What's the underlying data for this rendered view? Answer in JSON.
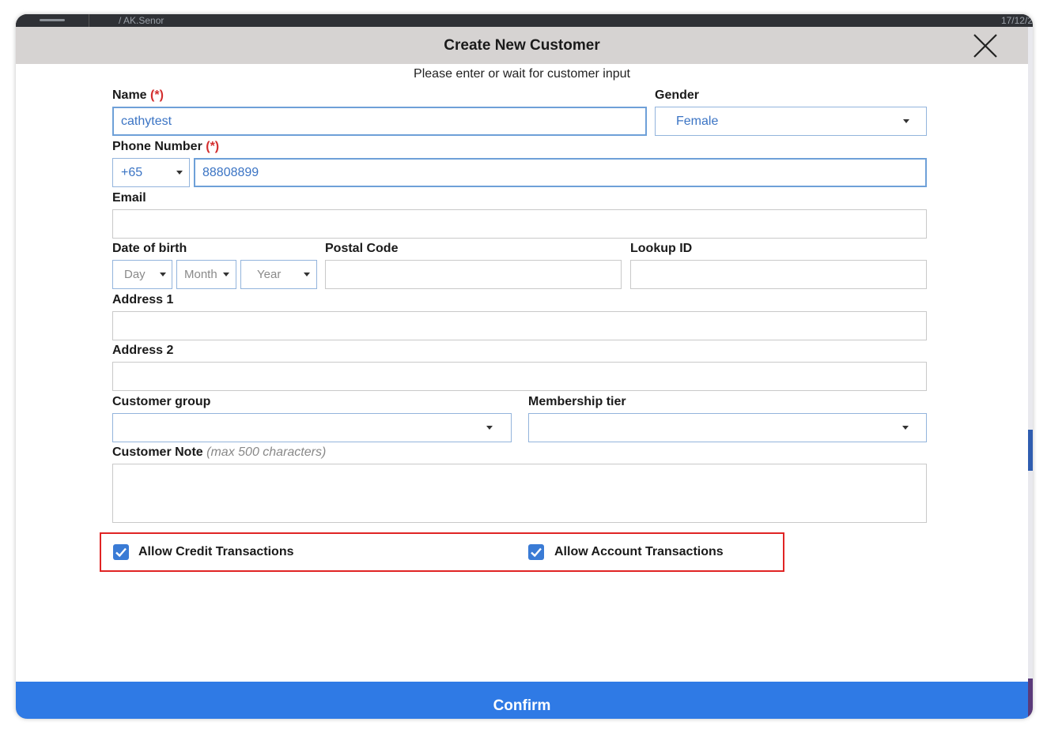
{
  "topbar": {
    "breadcrumb": "/ AK.Senor",
    "date": "17/12/2"
  },
  "dialog": {
    "title": "Create New Customer",
    "subtitle": "Please enter or wait for customer input",
    "confirm_label": "Confirm"
  },
  "form": {
    "name": {
      "label": "Name",
      "required_mark": "(*)",
      "value": "cathytest"
    },
    "gender": {
      "label": "Gender",
      "value": "Female"
    },
    "phone": {
      "label": "Phone Number",
      "required_mark": "(*)",
      "country_code": "+65",
      "value": "88808899"
    },
    "email": {
      "label": "Email",
      "value": ""
    },
    "dob": {
      "label": "Date of birth",
      "day_placeholder": "Day",
      "month_placeholder": "Month",
      "year_placeholder": "Year"
    },
    "postal_code": {
      "label": "Postal Code",
      "value": ""
    },
    "lookup_id": {
      "label": "Lookup ID",
      "value": ""
    },
    "address1": {
      "label": "Address 1",
      "value": ""
    },
    "address2": {
      "label": "Address 2",
      "value": ""
    },
    "customer_group": {
      "label": "Customer group",
      "value": ""
    },
    "membership_tier": {
      "label": "Membership tier",
      "value": ""
    },
    "customer_note": {
      "label": "Customer Note",
      "hint": "(max 500 characters)",
      "value": ""
    },
    "allow_credit": {
      "label": "Allow Credit Transactions",
      "checked": true
    },
    "allow_account": {
      "label": "Allow Account Transactions",
      "checked": true
    }
  },
  "colors": {
    "header_bg": "#d6d3d2",
    "accent_blue": "#2f7ae5",
    "required_red": "#d32f2f",
    "highlight_red": "#e02424",
    "value_blue": "#3b74c4"
  },
  "icons": {
    "close": "close-x-icon",
    "checkbox": "checkmark-icon",
    "caret": "caret-down-icon"
  }
}
